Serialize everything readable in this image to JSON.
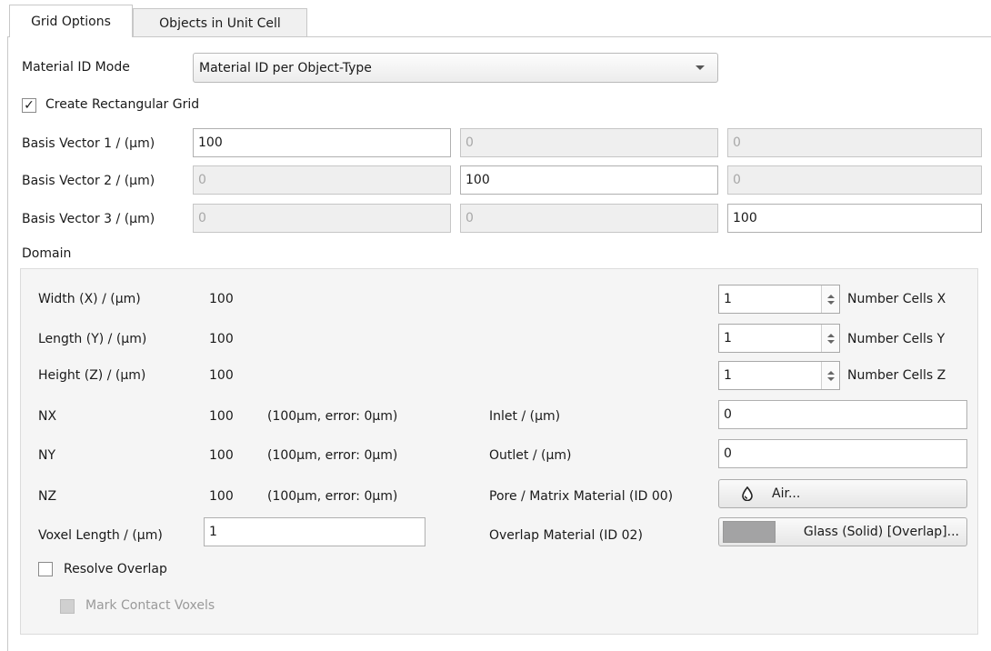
{
  "tabs": [
    {
      "label": "Grid Options",
      "active": true
    },
    {
      "label": "Objects in Unit Cell",
      "active": false
    }
  ],
  "material_mode": {
    "label": "Material ID Mode",
    "value": "Material ID per Object-Type"
  },
  "rect_grid": {
    "label": "Create Rectangular Grid",
    "checked": true
  },
  "basis": [
    {
      "label": "Basis Vector 1 / (µm)",
      "values": [
        "100",
        "0",
        "0"
      ],
      "enabled": [
        true,
        false,
        false
      ]
    },
    {
      "label": "Basis Vector 2 / (µm)",
      "values": [
        "0",
        "100",
        "0"
      ],
      "enabled": [
        false,
        true,
        false
      ]
    },
    {
      "label": "Basis Vector 3 / (µm)",
      "values": [
        "0",
        "0",
        "100"
      ],
      "enabled": [
        false,
        false,
        true
      ]
    }
  ],
  "domain": {
    "title": "Domain",
    "width": {
      "label": "Width (X) / (µm)",
      "value": "100"
    },
    "length": {
      "label": "Length (Y) / (µm)",
      "value": "100"
    },
    "height": {
      "label": "Height (Z) / (µm)",
      "value": "100"
    },
    "nx": {
      "label": "NX",
      "value": "100",
      "note": "(100µm, error: 0µm)"
    },
    "ny": {
      "label": "NY",
      "value": "100",
      "note": "(100µm, error: 0µm)"
    },
    "nz": {
      "label": "NZ",
      "value": "100",
      "note": "(100µm, error: 0µm)"
    },
    "voxel": {
      "label": "Voxel Length / (µm)",
      "value": "1"
    },
    "cells_x": {
      "label": "Number Cells X",
      "value": "1"
    },
    "cells_y": {
      "label": "Number Cells Y",
      "value": "1"
    },
    "cells_z": {
      "label": "Number Cells Z",
      "value": "1"
    },
    "inlet": {
      "label": "Inlet / (µm)",
      "value": "0"
    },
    "outlet": {
      "label": "Outlet / (µm)",
      "value": "0"
    },
    "pore": {
      "label": "Pore / Matrix Material (ID 00)",
      "button": "Air...",
      "icon": "droplet-icon"
    },
    "overlap_material": {
      "label": "Overlap Material (ID 02)",
      "button": "Glass (Solid) [Overlap]...",
      "swatch_color": "#a3a3a4"
    },
    "resolve_overlap": {
      "label": "Resolve Overlap",
      "checked": false
    },
    "mark_contact": {
      "label": "Mark Contact Voxels",
      "checked": false,
      "enabled": false
    }
  }
}
